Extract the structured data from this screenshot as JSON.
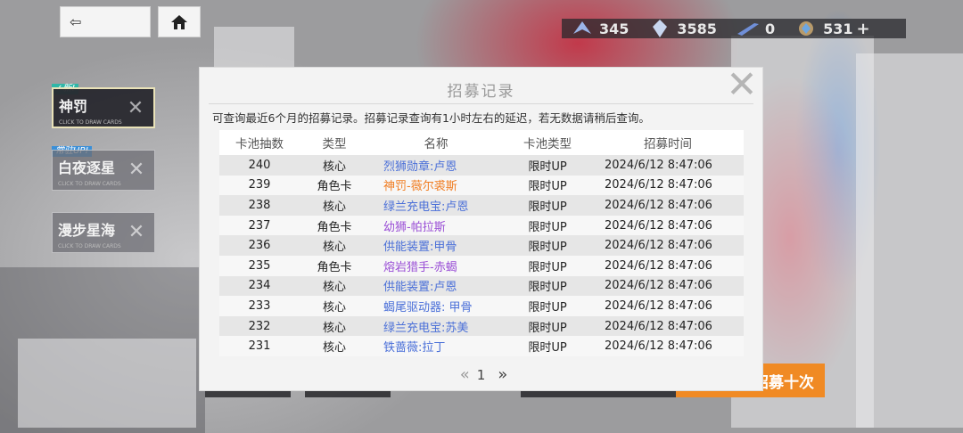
{
  "nav": {
    "back_icon": "back-arrow-icon",
    "back_glyph": "⇦",
    "home_icon": "home-icon"
  },
  "currency": [
    {
      "icon": "ship-icon",
      "value": "345"
    },
    {
      "icon": "crystal-icon",
      "value": "3585"
    },
    {
      "icon": "blade-icon",
      "value": "0"
    },
    {
      "icon": "gem-icon",
      "value": "531",
      "plus": "+"
    }
  ],
  "pool_tabs": [
    {
      "badge": "✓新!",
      "label": "神罚",
      "sub": "CLICK TO DRAW CARDS",
      "active": true
    },
    {
      "badge": "常驻UP!",
      "label": "白夜逐星",
      "sub": "CLICK TO DRAW CARDS",
      "active": false
    },
    {
      "badge": "",
      "label": "漫步星海",
      "sub": "CLICK TO DRAW CARDS",
      "active": false
    }
  ],
  "recruit_ten_label": "招募十次",
  "modal": {
    "title": "招募记录",
    "note": "可查询最近6个月的招募记录。招募记录查询有1小时左右的延迟，若无数据请稍后查询。",
    "columns": [
      "卡池抽数",
      "类型",
      "名称",
      "卡池类型",
      "招募时间"
    ],
    "rows": [
      {
        "count": "240",
        "type": "核心",
        "name": "烈狮勋章:卢恩",
        "pool": "限时UP",
        "time": "2024/6/12 8:47:06",
        "color": "#4a6fd8"
      },
      {
        "count": "239",
        "type": "角色卡",
        "name": "神罚-薇尔裘斯",
        "pool": "限时UP",
        "time": "2024/6/12 8:47:06",
        "color": "#f07d22"
      },
      {
        "count": "238",
        "type": "核心",
        "name": "绿兰充电宝:卢恩",
        "pool": "限时UP",
        "time": "2024/6/12 8:47:06",
        "color": "#4a6fd8"
      },
      {
        "count": "237",
        "type": "角色卡",
        "name": "幼狮-帕拉斯",
        "pool": "限时UP",
        "time": "2024/6/12 8:47:06",
        "color": "#9a4fd6"
      },
      {
        "count": "236",
        "type": "核心",
        "name": "供能装置:甲骨",
        "pool": "限时UP",
        "time": "2024/6/12 8:47:06",
        "color": "#4a6fd8"
      },
      {
        "count": "235",
        "type": "角色卡",
        "name": "熔岩猎手-赤蝎",
        "pool": "限时UP",
        "time": "2024/6/12 8:47:06",
        "color": "#9a4fd6"
      },
      {
        "count": "234",
        "type": "核心",
        "name": "供能装置:卢恩",
        "pool": "限时UP",
        "time": "2024/6/12 8:47:06",
        "color": "#4a6fd8"
      },
      {
        "count": "233",
        "type": "核心",
        "name": "蝎尾驱动器: 甲骨",
        "pool": "限时UP",
        "time": "2024/6/12 8:47:06",
        "color": "#4a6fd8"
      },
      {
        "count": "232",
        "type": "核心",
        "name": "绿兰充电宝:苏美",
        "pool": "限时UP",
        "time": "2024/6/12 8:47:06",
        "color": "#4a6fd8"
      },
      {
        "count": "231",
        "type": "核心",
        "name": "铁蔷薇:拉丁",
        "pool": "限时UP",
        "time": "2024/6/12 8:47:06",
        "color": "#4a6fd8"
      }
    ],
    "pager": {
      "prev": "«",
      "page": "1",
      "next": "»"
    },
    "close_icon": "close-icon"
  }
}
